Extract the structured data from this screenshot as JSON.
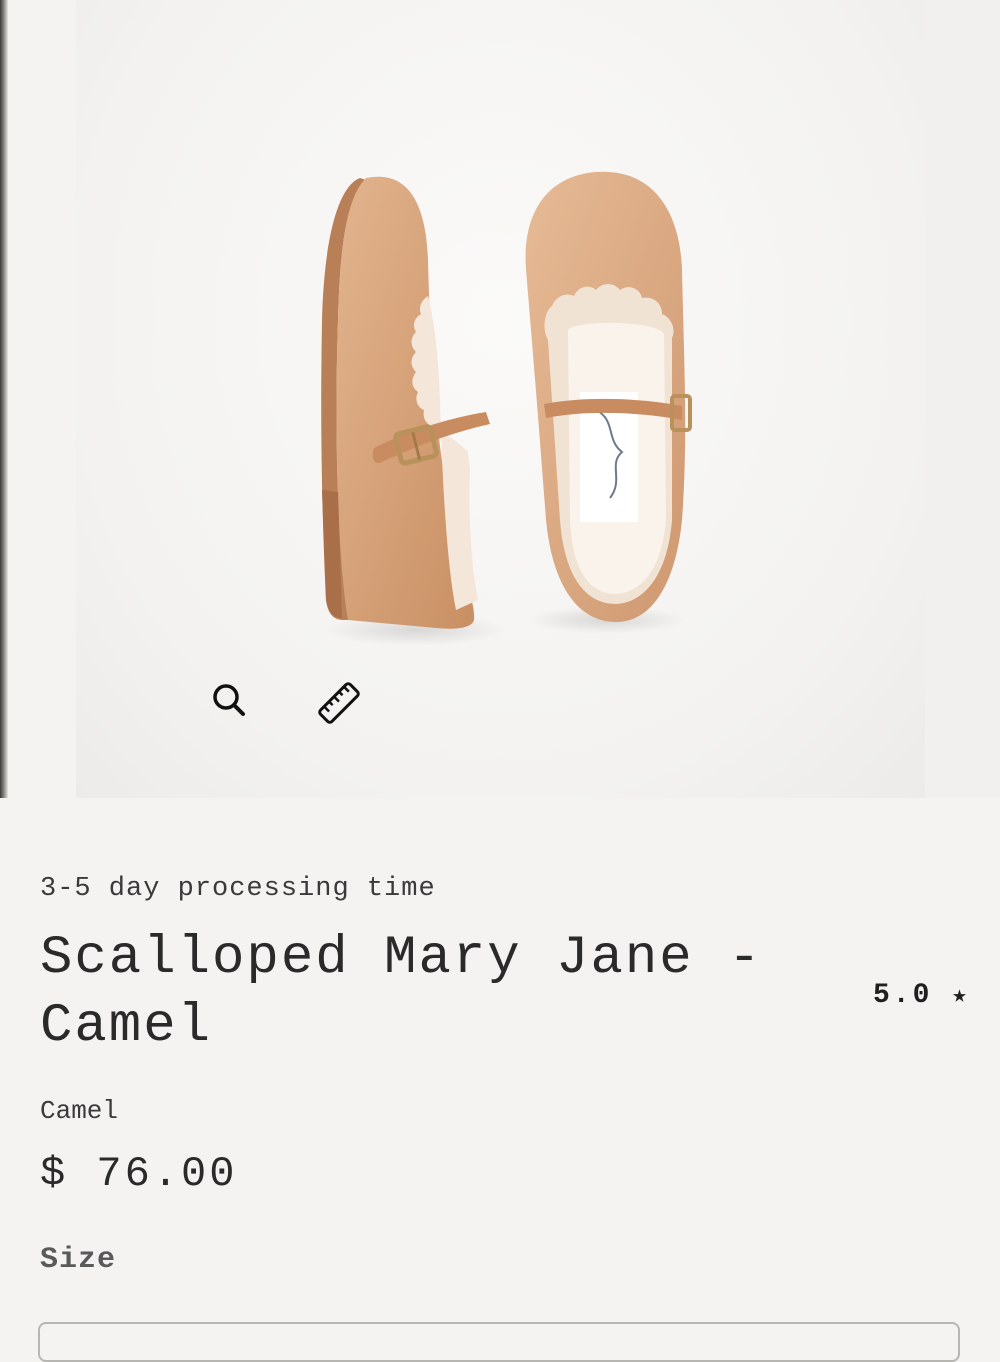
{
  "product": {
    "processing_time": "3-5 day processing time",
    "title": "Scalloped Mary Jane - Camel",
    "rating": "5.0",
    "rating_star": "★",
    "variant": "Camel",
    "price": "$ 76.00"
  },
  "image_controls": {
    "zoom_icon": "magnifier-icon",
    "size_guide_icon": "ruler-icon"
  },
  "options": {
    "size_label": "Size"
  },
  "colors": {
    "background": "#f4f3f1",
    "leather": "#d8a57d",
    "text": "#2a2a2a"
  }
}
